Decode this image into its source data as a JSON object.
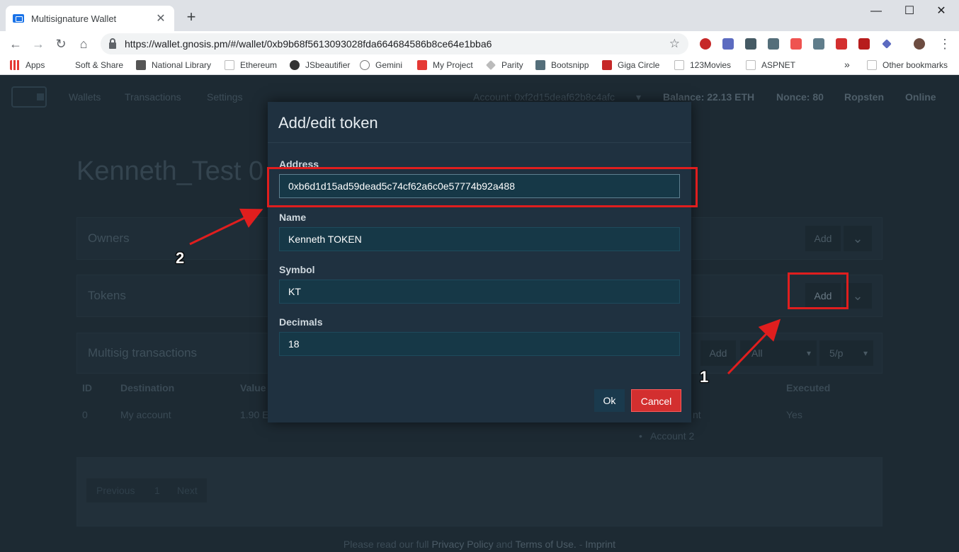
{
  "browser": {
    "tab_title": "Multisignature Wallet",
    "tab_close": "✕",
    "new_tab": "+",
    "window_controls": {
      "minimize": "—",
      "maximize": "☐",
      "close": "✕"
    },
    "url": "https://wallet.gnosis.pm/#/wallet/0xb9b68f5613093028fda664684586b8ce64e1bba6",
    "bookmarks": [
      "Apps",
      "Soft & Share",
      "National Library",
      "Ethereum",
      "JSbeautifier",
      "Gemini",
      "My Project",
      "Parity",
      "Bootsnipp",
      "Giga Circle",
      "123Movies",
      "ASPNET"
    ],
    "more_bookmarks": "»",
    "other_bookmarks": "Other bookmarks"
  },
  "nav": {
    "wallets": "Wallets",
    "transactions": "Transactions",
    "settings": "Settings",
    "account": "Account: 0xf2d15deaf62b8c4afc",
    "balance": "Balance: 22.13 ETH",
    "nonce": "Nonce: 80",
    "network": "Ropsten",
    "status": "Online"
  },
  "wallet": {
    "title": "Kenneth_Test 0"
  },
  "owners_panel": {
    "title": "Owners",
    "add_label": "Add"
  },
  "tokens_panel": {
    "title": "Tokens",
    "add_label": "Add"
  },
  "multisig_panel": {
    "title": "Multisig transactions",
    "add_label": "Add",
    "filter_value": "All",
    "page_size": "5/p"
  },
  "table": {
    "headers": [
      "ID",
      "Destination",
      "Value",
      "Executed"
    ],
    "row": {
      "id": "0",
      "destination": "My account",
      "value": "1.90 E",
      "confirmations_fragment": "nt",
      "confirmation_2": "Account 2",
      "executed": "Yes"
    }
  },
  "pagination": {
    "previous": "Previous",
    "page": "1",
    "next": "Next"
  },
  "footer": {
    "prefix": "Please read our full",
    "privacy": "Privacy Policy",
    "and": "and",
    "terms": "Terms of Use.",
    "dash": "-",
    "imprint": "Imprint"
  },
  "modal": {
    "title": "Add/edit token",
    "address_label": "Address",
    "address_value": "0xb6d1d15ad59dead5c74cf62a6c0e57774b92a488",
    "name_label": "Name",
    "name_value": "Kenneth TOKEN",
    "symbol_label": "Symbol",
    "symbol_value": "KT",
    "decimals_label": "Decimals",
    "decimals_value": "18",
    "ok_label": "Ok",
    "cancel_label": "Cancel"
  },
  "annotations": {
    "callout_1": "1",
    "callout_2": "2",
    "highlight_color": "#e01e1e"
  },
  "icons": {
    "back": "arrow-left-icon",
    "forward": "arrow-right-icon",
    "reload": "reload-icon",
    "home": "home-icon",
    "lock": "lock-icon",
    "star": "star-icon",
    "menu": "more-vertical-icon",
    "chevron": "chevron-down-icon",
    "caret": "caret-down-icon"
  },
  "glyphs": {
    "back": "←",
    "forward": "→",
    "reload": "↻",
    "home": "⌂",
    "star": "☆",
    "menu": "⋮",
    "chevron": "⌄",
    "caret": "▾",
    "bullet": "•"
  },
  "colors": {
    "page_bg": "#1d2a33",
    "modal_bg": "#1f3140",
    "input_bg": "#163847",
    "cancel": "#d32f2f"
  }
}
